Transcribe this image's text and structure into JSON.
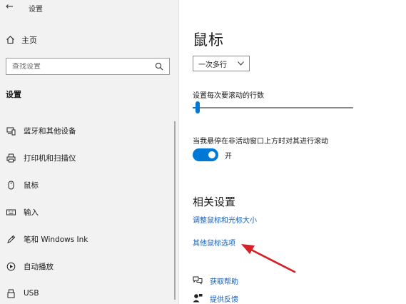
{
  "window": {
    "title": "设置",
    "back_icon": "back-arrow-icon"
  },
  "sidebar": {
    "home_label": "主页",
    "search_placeholder": "查找设置",
    "section_header": "设置",
    "items": [
      {
        "label": "蓝牙和其他设备",
        "icon": "bluetooth-devices-icon"
      },
      {
        "label": "打印机和扫描仪",
        "icon": "printer-icon"
      },
      {
        "label": "鼠标",
        "icon": "mouse-icon"
      },
      {
        "label": "输入",
        "icon": "keyboard-icon"
      },
      {
        "label": "笔和 Windows Ink",
        "icon": "pen-icon"
      },
      {
        "label": "自动播放",
        "icon": "autoplay-icon"
      },
      {
        "label": "USB",
        "icon": "usb-icon"
      }
    ]
  },
  "main": {
    "title": "鼠标",
    "scroll_mode": {
      "selected": "一次多行"
    },
    "scroll_lines": {
      "label": "设置每次要滚动的行数",
      "value_fraction": 0.02
    },
    "inactive_scroll": {
      "label": "当我悬停在非活动窗口上方时对其进行滚动",
      "state": "开"
    },
    "related": {
      "title": "相关设置",
      "links": [
        "调整鼠标和光标大小",
        "其他鼠标选项"
      ]
    },
    "help": {
      "get_help": "获取帮助",
      "feedback": "提供反馈"
    }
  },
  "colors": {
    "accent": "#0078d7",
    "link": "#1a5fb4",
    "annotation_arrow": "#d81f26"
  }
}
